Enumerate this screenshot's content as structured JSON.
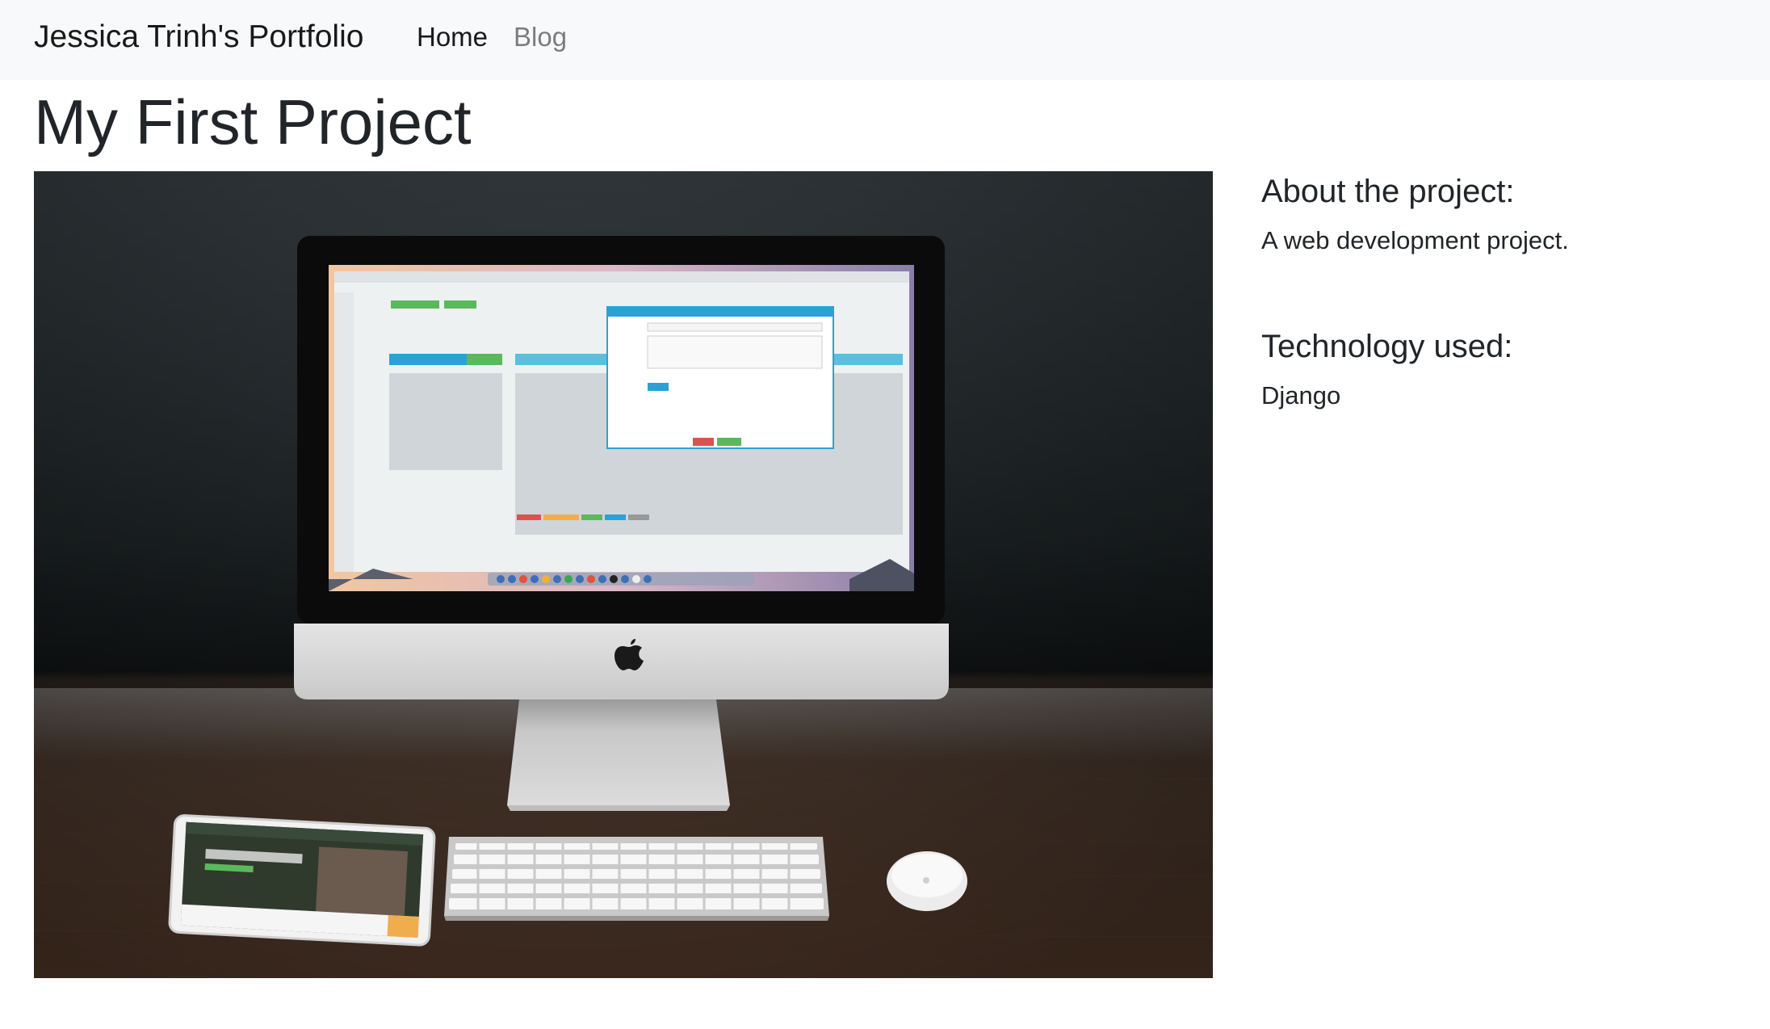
{
  "navbar": {
    "brand": "Jessica Trinh's Portfolio",
    "links": [
      {
        "label": "Home",
        "active": true
      },
      {
        "label": "Blog",
        "active": false
      }
    ]
  },
  "page": {
    "title": "My First Project"
  },
  "image": {
    "subject": "iMac desktop computer, iPad tablet, keyboard and mouse on a wooden desk"
  },
  "sidebar": {
    "about_heading": "About the project:",
    "about_text": "A web development project.",
    "tech_heading": "Technology used:",
    "tech_text": "Django"
  },
  "colors": {
    "navbar_bg": "#f8f9fa",
    "text": "#212529",
    "nav_inactive": "rgba(0,0,0,0.5)"
  }
}
